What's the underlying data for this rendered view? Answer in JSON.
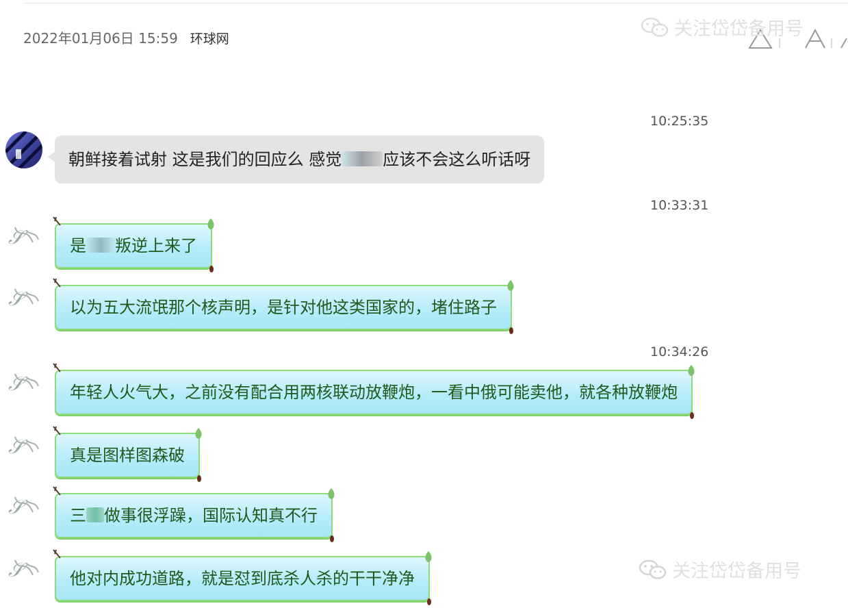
{
  "header": {
    "datetime": "2022年01月06日 15:59",
    "source": "环球网"
  },
  "watermark": "关注岱岱备用号",
  "messages": [
    {
      "time": "10:25:35",
      "pre": "朝鲜接着试射 这是我们的回应么 感觉",
      "post": "应该不会这么听话呀"
    },
    {
      "time": "10:33:31",
      "pre": "是",
      "post": "叛逆上来了"
    },
    {
      "text": "以为五大流氓那个核声明，是针对他这类国家的，堵住路子"
    },
    {
      "time": "10:34:26",
      "text": "年轻人火气大，之前没有配合用两核联动放鞭炮，一看中俄可能卖他，就各种放鞭炮"
    },
    {
      "text": "真是图样图森破"
    },
    {
      "pre": "三",
      "post": "做事很浮躁，国际认知真不行"
    },
    {
      "text": "他对内成功道路，就是怼到底杀人杀的干干净净"
    }
  ],
  "colors": {
    "bubble_fill": "#b6ecfb",
    "bubble_border": "#8fdb7a",
    "bubble_text": "#1f5a1c",
    "grey_bubble": "#e4e4e4"
  }
}
